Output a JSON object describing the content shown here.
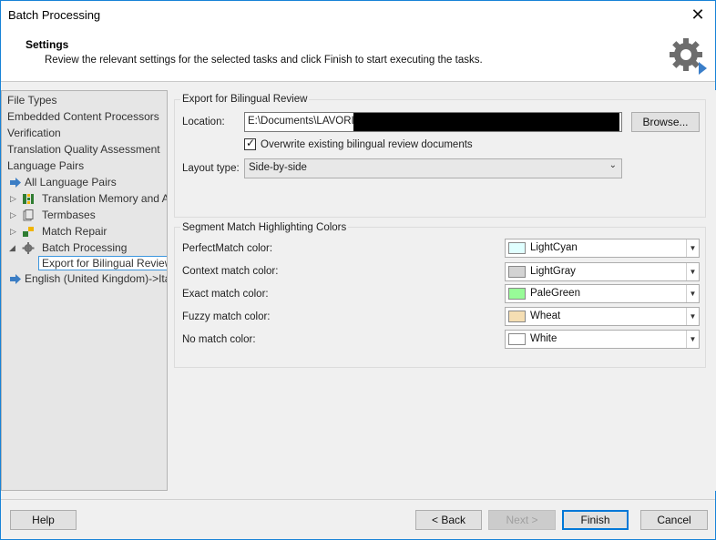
{
  "window": {
    "title": "Batch Processing",
    "close_glyph": "✕"
  },
  "header": {
    "title": "Settings",
    "description": "Review the relevant settings for the selected tasks and click Finish to start executing the tasks.",
    "icon": "gear-icon"
  },
  "tree": {
    "items": [
      {
        "label": "File Types"
      },
      {
        "label": "Embedded Content Processors"
      },
      {
        "label": "Verification"
      },
      {
        "label": "Translation Quality Assessment"
      },
      {
        "label": "Language Pairs"
      },
      {
        "label": "All Language Pairs"
      },
      {
        "label": "Translation Memory and A"
      },
      {
        "label": "Termbases"
      },
      {
        "label": "Match Repair"
      },
      {
        "label": "Batch Processing"
      },
      {
        "label": "Export for Bilingual Review"
      },
      {
        "label": "English (United Kingdom)->Ital"
      }
    ]
  },
  "export": {
    "group_title": "Export for Bilingual Review",
    "location_label": "Location:",
    "location_value": "E:\\Documents\\LAVORI\\",
    "browse_label": "Browse...",
    "overwrite_label": "Overwrite existing bilingual review documents",
    "overwrite_checked": true,
    "layout_label": "Layout type:",
    "layout_value": "Side-by-side"
  },
  "colors": {
    "group_title": "Segment Match Highlighting Colors",
    "rows": [
      {
        "label": "PerfectMatch color:",
        "value": "LightCyan",
        "hex": "#e0ffff"
      },
      {
        "label": "Context match color:",
        "value": "LightGray",
        "hex": "#d3d3d3"
      },
      {
        "label": "Exact match color:",
        "value": "PaleGreen",
        "hex": "#98fb98"
      },
      {
        "label": "Fuzzy match color:",
        "value": "Wheat",
        "hex": "#f5deb3"
      },
      {
        "label": "No match color:",
        "value": "White",
        "hex": "#ffffff"
      }
    ]
  },
  "footer": {
    "help": "Help",
    "back": "< Back",
    "next": "Next >",
    "finish": "Finish",
    "cancel": "Cancel"
  },
  "accent": "#0078d7"
}
